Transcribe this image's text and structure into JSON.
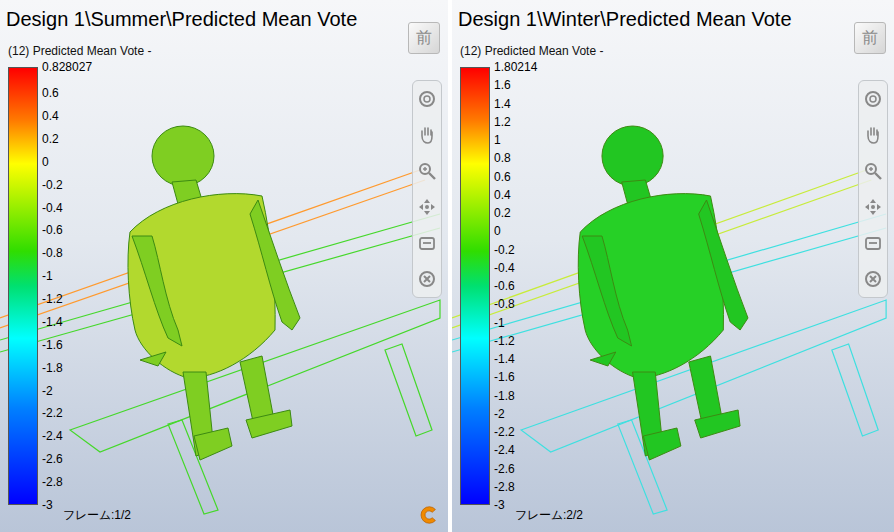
{
  "panels": [
    {
      "title": "Design 1\\Summer\\Predicted Mean Vote",
      "subtitle": "(12) Predicted Mean Vote -",
      "view_cube_label": "前",
      "legend_max": "0.828027",
      "ticks": [
        "0.6",
        "0.4",
        "0.2",
        "0",
        "-0.2",
        "-0.4",
        "-0.6",
        "-0.8",
        "-1",
        "-1.2",
        "-1.4",
        "-1.6",
        "-1.8",
        "-2",
        "-2.2",
        "-2.4",
        "-2.6",
        "-2.8",
        "-3"
      ],
      "frame": "フレーム:1/2",
      "figure_color": "#7fce22",
      "torso_color": "#b2d92e",
      "line_colors": [
        "#ff9a2e",
        "#45d82a"
      ],
      "logo": true
    },
    {
      "title": "Design 1\\Winter\\Predicted Mean Vote",
      "subtitle": "(12) Predicted Mean Vote -",
      "view_cube_label": "前",
      "legend_max": "1.80214",
      "ticks": [
        "1.6",
        "1.4",
        "1.2",
        "1",
        "0.8",
        "0.6",
        "0.4",
        "0.2",
        "0",
        "-0.2",
        "-0.4",
        "-0.6",
        "-0.8",
        "-1",
        "-1.2",
        "-1.4",
        "-1.6",
        "-1.8",
        "-2",
        "-2.2",
        "-2.4",
        "-2.6",
        "-2.8",
        "-3"
      ],
      "frame": "フレーム:2/2",
      "figure_color": "#22c622",
      "torso_color": "#26d026",
      "line_colors": [
        "#c8ec3a",
        "#3ee0e0"
      ],
      "logo": false
    }
  ]
}
